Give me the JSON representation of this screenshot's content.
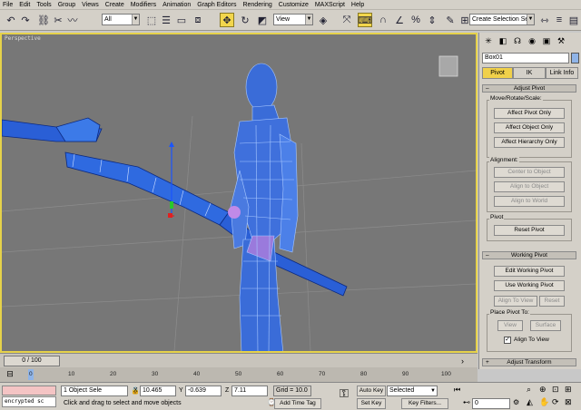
{
  "menu": [
    "File",
    "Edit",
    "Tools",
    "Group",
    "Views",
    "Create",
    "Modifiers",
    "Animation",
    "Graph Editors",
    "Rendering",
    "Customize",
    "MAXScript",
    "Help"
  ],
  "toolbar": {
    "filter_value": "All",
    "coord_value": "View",
    "selection_set_placeholder": "Create Selection Set"
  },
  "viewport": {
    "label": "Perspective"
  },
  "command_panel": {
    "object_name": "Box01",
    "object_color": "#8fb4e8",
    "tabs": [
      "Pivot",
      "IK",
      "Link Info"
    ],
    "adjust_pivot": {
      "title": "Adjust Pivot",
      "move_group": "Move/Rotate/Scale:",
      "buttons": [
        "Affect Pivot Only",
        "Affect Object Only",
        "Affect Hierarchy Only"
      ],
      "alignment_group": "Alignment:",
      "alignment_buttons": [
        "Center to Object",
        "Align to Object",
        "Align to World"
      ],
      "pivot_group": "Pivot",
      "reset_pivot": "Reset Pivot"
    },
    "working_pivot": {
      "title": "Working Pivot",
      "edit": "Edit Working Pivot",
      "use": "Use Working Pivot",
      "align_to_view": "Align To View",
      "reset": "Reset",
      "place_group": "Place Pivot To:",
      "view": "View",
      "surface": "Surface",
      "align_to_view_check": "Align To View"
    },
    "adjust_transform": {
      "title": "Adjust Transform"
    }
  },
  "time_slider": {
    "label": "0 / 100"
  },
  "track_ticks": [
    "0",
    "10",
    "20",
    "30",
    "40",
    "50",
    "60",
    "70",
    "80",
    "90",
    "100"
  ],
  "status": {
    "maxscript": "encrypted sc",
    "selection": "1 Object Sele",
    "prompt": "Click and drag to select and move objects",
    "x_label": "X",
    "x_value": "10.465",
    "y_label": "Y",
    "y_value": "-0.639",
    "z_label": "Z",
    "z_value": "7.11",
    "grid": "Grid = 10.0",
    "add_time_tag": "Add Time Tag",
    "auto_key": "Auto Key",
    "auto_key_value": "Selected",
    "set_key": "Set Key",
    "key_filters": "Key Filters...",
    "frame": "0"
  }
}
